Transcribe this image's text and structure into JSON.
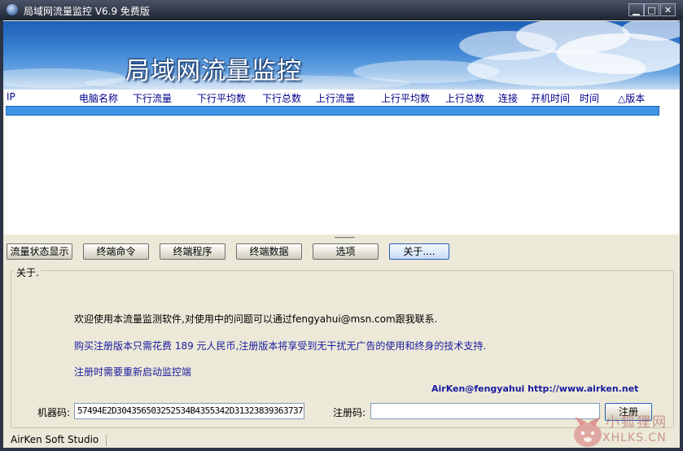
{
  "window": {
    "title": "局域网流量监控 V6.9   免费版",
    "min_label": "▁",
    "max_label": "□",
    "close_label": "✕"
  },
  "banner": {
    "title": "局域网流量监控"
  },
  "list": {
    "columns": [
      "IP",
      "电脑名称",
      "下行流量",
      "下行平均数",
      "下行总数",
      "上行流量",
      "上行平均数",
      "上行总数",
      "连接",
      "开机时间",
      "时间",
      "△版本"
    ]
  },
  "splitter": {
    "grip": "-----------"
  },
  "tabs": [
    "流量状态显示",
    "终端命令",
    "终端程序",
    "终端数据",
    "选项",
    "关于...."
  ],
  "about": {
    "legend": "关于.",
    "line1": "欢迎使用本流量监测软件,对使用中的问题可以通过fengyahui@msn.com跟我联系.",
    "line2": "购买注册版本只需花费 189 元人民币,注册版本将享受到无干扰无广告的使用和终身的技术支持.",
    "line3": "注册时需要重新启动监控端",
    "contact": "AirKen@fengyahui  http://www.airken.net"
  },
  "registration": {
    "machine_label": "机器码:",
    "machine_code": "57494E2D304356503252534B4355342D31323839363737",
    "reg_label": "注册码:",
    "reg_code": "",
    "reg_button": "注册"
  },
  "status": {
    "text": "AirKen Soft Studio"
  },
  "watermark": {
    "line1": "小狐狸网",
    "line2": "XHLKS.CN"
  },
  "colors": {
    "link_blue": "#1a1aa0",
    "header_text": "#00008b",
    "selection": "#3d95e8"
  }
}
